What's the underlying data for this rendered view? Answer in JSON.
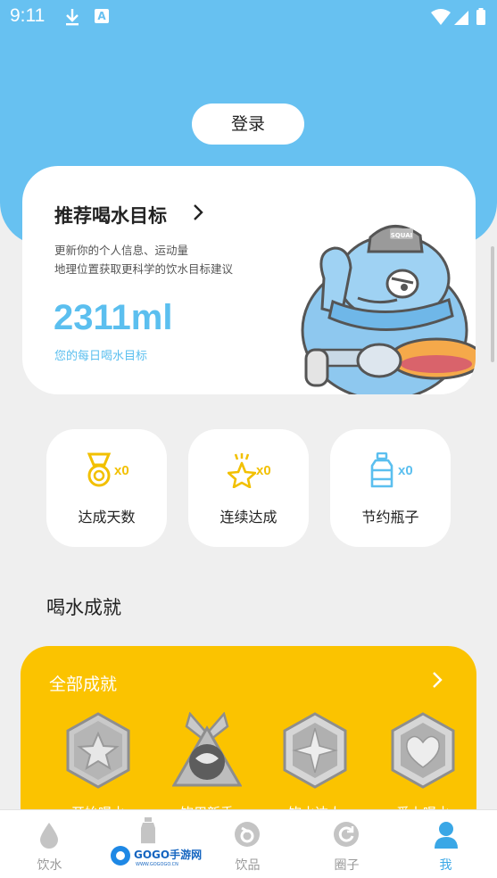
{
  "status_bar": {
    "time": "9:11"
  },
  "header": {
    "login_label": "登录"
  },
  "recommend": {
    "title": "推荐喝水目标",
    "desc_line1": "更新你的个人信息、运动量",
    "desc_line2": "地理位置获取更科学的饮水目标建议",
    "target_value": "2311ml",
    "target_caption": "您的每日喝水目标",
    "mascot_cap_text": "SQUAI"
  },
  "stats": [
    {
      "icon": "medal-icon",
      "count": "x0",
      "label": "达成天数"
    },
    {
      "icon": "star-icon",
      "count": "x0",
      "label": "连续达成"
    },
    {
      "icon": "bottle-icon",
      "count": "x0",
      "label": "节约瓶子"
    }
  ],
  "achievements": {
    "section_title": "喝水成就",
    "card_title": "全部成就",
    "badges": [
      {
        "icon": "star-badge-icon",
        "label": "开始喝水"
      },
      {
        "icon": "mask-badge-icon",
        "label": "饮用新手"
      },
      {
        "icon": "compass-badge-icon",
        "label": "饮水达人"
      },
      {
        "icon": "heart-badge-icon",
        "label": "爱上喝水"
      }
    ]
  },
  "tabbar": {
    "items": [
      {
        "icon": "water-drop-icon",
        "label": "饮水"
      },
      {
        "icon": "bottle-tab-icon",
        "label": ""
      },
      {
        "icon": "drink-icon",
        "label": "饮品"
      },
      {
        "icon": "circle-refresh-icon",
        "label": "圈子"
      },
      {
        "icon": "user-icon",
        "label": "我"
      }
    ],
    "active_index": 4
  },
  "watermark": {
    "text": "GOGO手游网",
    "sub": "WWW.GOGOGO.CN"
  },
  "colors": {
    "accent": "#67c1f1",
    "achievement": "#fbc300",
    "icon_gold": "#f2c000",
    "icon_blue": "#5bbfef"
  }
}
